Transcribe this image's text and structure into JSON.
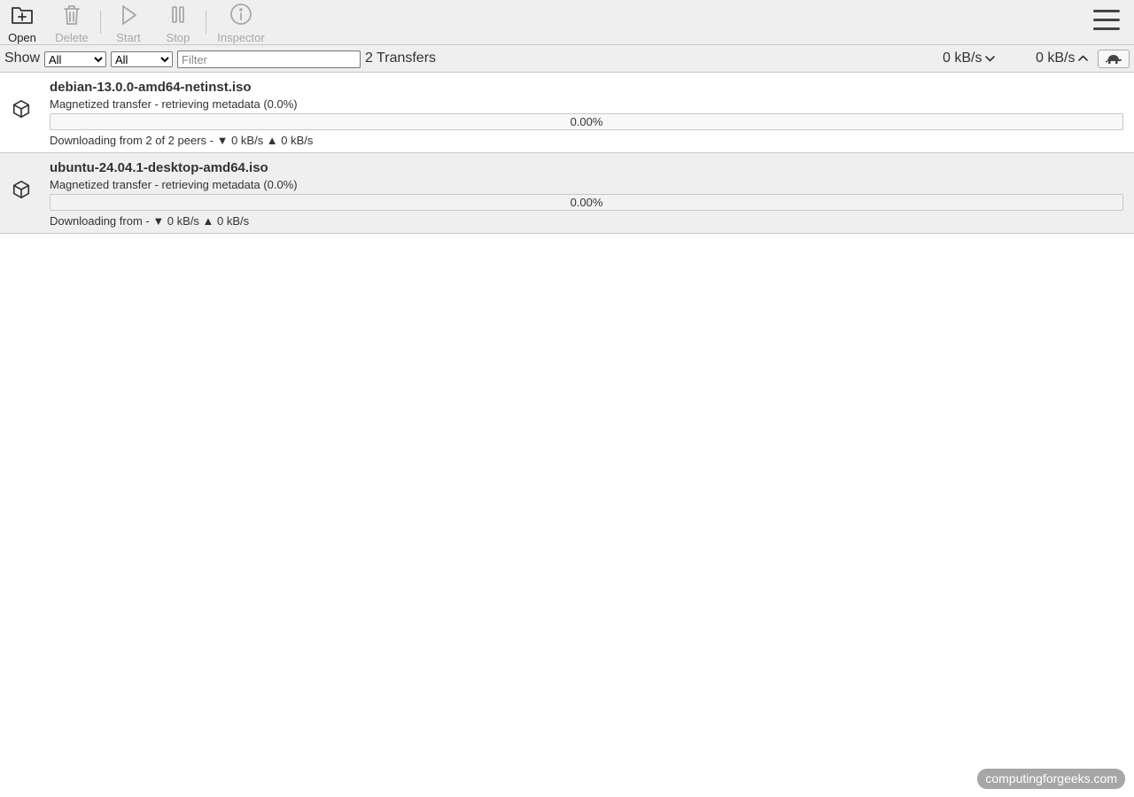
{
  "toolbar": {
    "open_label": "Open",
    "delete_label": "Delete",
    "start_label": "Start",
    "stop_label": "Stop",
    "inspector_label": "Inspector"
  },
  "filterbar": {
    "show_label": "Show",
    "activity_filter": {
      "selected": "All",
      "options": [
        "All"
      ]
    },
    "tracker_filter": {
      "selected": "All",
      "options": [
        "All"
      ]
    },
    "filter_placeholder": "Filter",
    "filter_value": "",
    "transfer_count": "2 Transfers",
    "download_speed": "0 kB/s",
    "upload_speed": "0 kB/s"
  },
  "torrents": [
    {
      "name": "debian-13.0.0-amd64-netinst.iso",
      "status": "Magnetized transfer - retrieving metadata (0.0%)",
      "progress_text": "0.00%",
      "progress": 0.0,
      "peers": "Downloading from 2 of 2 peers - ▼ 0 kB/s ▲ 0 kB/s"
    },
    {
      "name": "ubuntu-24.04.1-desktop-amd64.iso",
      "status": "Magnetized transfer - retrieving metadata (0.0%)",
      "progress_text": "0.00%",
      "progress": 0.0,
      "peers": "Downloading from - ▼ 0 kB/s ▲ 0 kB/s"
    }
  ],
  "watermark": "computingforgeeks.com",
  "icons": {
    "open": "folder-plus-icon",
    "delete": "trash-icon",
    "start": "play-icon",
    "stop": "pause-icon",
    "inspector": "info-icon",
    "menu": "hamburger-icon",
    "download": "chevron-down-icon",
    "upload": "chevron-up-icon",
    "turtle": "turtle-icon",
    "torrent": "package-icon"
  },
  "colors": {
    "toolbar_bg": "#efefef",
    "border": "#c8c8c8",
    "disabled_text": "#a8a8a8",
    "odd_row_bg": "#ffffff",
    "even_row_bg": "#efefef"
  }
}
